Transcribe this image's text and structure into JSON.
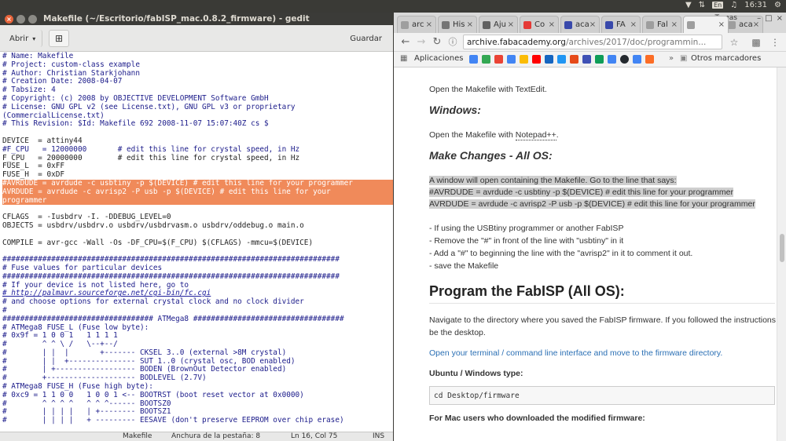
{
  "system": {
    "keyboard_layout": "En",
    "time": "16:31",
    "user": "Tomas"
  },
  "gedit": {
    "title": "Makefile (~/Escritorio/fabISP_mac.0.8.2_firmware) - gedit",
    "open_label": "Abrir",
    "save_label": "Guardar",
    "status": {
      "language": "Makefile",
      "tab_width": "Anchura de la pestaña: 8",
      "position": "Ln 16, Col 75",
      "mode": "INS"
    },
    "lines": [
      "# Name: Makefile",
      "# Project: custom-class example",
      "# Author: Christian Starkjohann",
      "# Creation Date: 2008-04-07",
      "# Tabsize: 4",
      "# Copyright: (c) 2008 by OBJECTIVE DEVELOPMENT Software GmbH",
      "# License: GNU GPL v2 (see License.txt), GNU GPL v3 or proprietary",
      "(CommercialLicense.txt)",
      "# This Revision: $Id: Makefile 692 2008-11-07 15:07:40Z cs $",
      "",
      "DEVICE  = attiny44",
      "#F_CPU   = 12000000       # edit this line for crystal speed, in Hz",
      "F_CPU   = 20000000        # edit this line for crystal speed, in Hz",
      "FUSE_L  = 0xFF",
      "FUSE_H  = 0xDF",
      "#AVRDUDE = avrdude -c usbtiny -p $(DEVICE) # edit this line for your programmer",
      "AVRDUDE = avrdude -c avrisp2 -P usb -p $(DEVICE) # edit this line for your",
      "programmer",
      "",
      "CFLAGS  = -Iusbdrv -I. -DDEBUG_LEVEL=0",
      "OBJECTS = usbdrv/usbdrv.o usbdrv/usbdrvasm.o usbdrv/oddebug.o main.o",
      "",
      "COMPILE = avr-gcc -Wall -Os -DF_CPU=$(F_CPU) $(CFLAGS) -mmcu=$(DEVICE)",
      "",
      "############################################################################",
      "# Fuse values for particular devices",
      "############################################################################",
      "# If your device is not listed here, go to",
      "# http://palmavr.sourceforge.net/cgi-bin/fc.cgi",
      "# and choose options for external crystal clock and no clock divider",
      "#",
      "################################## ATMega8 ##################################",
      "# ATMega8 FUSE_L (Fuse low byte):",
      "# 0x9f = 1 0 0 1   1 1 1 1",
      "#        ^ ^ \\ /   \\--+--/",
      "#        | |  |       +------- CKSEL 3..0 (external >8M crystal)",
      "#        | |  +--------------- SUT 1..0 (crystal osc, BOD enabled)",
      "#        | +------------------ BODEN (BrownOut Detector enabled)",
      "#        +-------------------- BODLEVEL (2.7V)",
      "# ATMega8 FUSE_H (Fuse high byte):",
      "# 0xc9 = 1 1 0 0   1 0 0 1 <-- BOOTRST (boot reset vector at 0x0000)",
      "#        ^ ^ ^ ^   ^ ^ ^------ BOOTSZ0",
      "#        | | | |   | +-------- BOOTSZ1",
      "#        | | | |   + --------- EESAVE (don't preserve EEPROM over chip erase)"
    ]
  },
  "chrome": {
    "tabs": [
      {
        "label": "arc",
        "favicon": "page-icon"
      },
      {
        "label": "His",
        "favicon": "history-icon"
      },
      {
        "label": "Aju",
        "favicon": "gear-icon"
      },
      {
        "label": "Co",
        "favicon": "fabacademy-icon"
      },
      {
        "label": "aca",
        "favicon": "fab-icon"
      },
      {
        "label": "FA",
        "favicon": "fab-icon"
      },
      {
        "label": "Fal",
        "favicon": "page-icon"
      },
      {
        "label": "",
        "favicon": "page-icon"
      },
      {
        "label": "aca",
        "favicon": "page-icon"
      }
    ],
    "user": "Tomas",
    "url_host": "archive.fabacademy.org",
    "url_path": "/archives/2017/doc/programmin...",
    "bookmarks": {
      "apps_label": "Aplicaciones",
      "other_label": "Otros marcadores"
    },
    "page": {
      "p1": "Open the Makefile with TextEdit.",
      "h_windows": "Windows:",
      "p2_pre": "Open the Makefile with ",
      "p2_link": "Notepad++",
      "p2_post": ".",
      "h_changes": "Make Changes - All OS:",
      "p3": "A window will open containing the Makefile. Go to the line that says:",
      "p4": "#AVRDUDE = avrdude -c usbtiny -p $(DEVICE) # edit this line for your programmer",
      "p5": "AVRDUDE = avrdude -c avrisp2 -P usb -p $(DEVICE) # edit this line for your programmer",
      "b1": "- If using the USBtiny programmer or another FabISP",
      "b2": "- Remove the \"#\" in front of the line with \"usbtiny\" in it",
      "b3": "- Add a \"#\" to beginning the line with the \"avrisp2\" in it to comment it out.",
      "b4": "- save the Makefile",
      "h_program": "Program the FabISP (All OS):",
      "p6": "Navigate to the directory where you saved the FabISP firmware. If you followed the instructions",
      "p6b": "be the desktop.",
      "p7": "Open your terminal / command line interface and move to the firmware directory.",
      "p8": "Ubuntu / Windows type:",
      "code1": "cd Desktop/firmware",
      "p9": "For Mac users who downloaded the modified firmware:"
    }
  }
}
